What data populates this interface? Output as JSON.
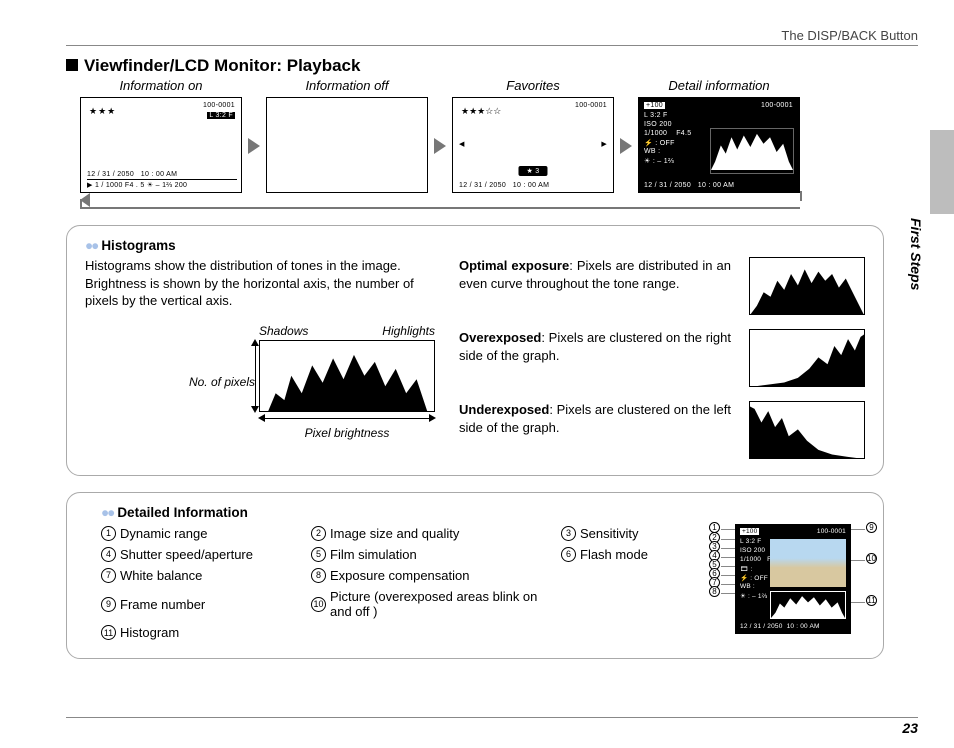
{
  "header_right": "The DISP/BACK Button",
  "section_title": "Viewfinder/LCD Monitor: Playback",
  "side_tab": "First Steps",
  "screens": {
    "s1": {
      "label": "Information on",
      "frame": "100-0001",
      "star": "★★★",
      "mode": "L 3:2 F",
      "date": "12 / 31 / 2050",
      "time": "10 : 00  AM",
      "bottom": "1 / 1000      F4 . 5      ☀ – 1⅔     200"
    },
    "s2": {
      "label": "Information off"
    },
    "s3": {
      "label": "Favorites",
      "frame": "100-0001",
      "star": "★★★☆☆",
      "badge": "★  3",
      "date": "12 / 31 / 2050",
      "time": "10 : 00  AM"
    },
    "s4": {
      "label": "Detail information",
      "frame": "100-0001",
      "dr": "+100",
      "mode": "L 3:2 F",
      "iso": "ISO 200",
      "ss": "1/1000",
      "ap": "F4.5",
      "flash": "⚡ : OFF",
      "wb": "WB :",
      "ec": "☀ : – 1⅔",
      "date": "12 / 31 / 2050",
      "time": "10 : 00  AM"
    }
  },
  "hist": {
    "title": "Histograms",
    "desc": "Histograms show the distribution of tones in the image.   Brightness is shown by the horizontal axis, the number of pixels by the vertical axis.",
    "y_label": "No. of pixels",
    "shadows": "Shadows",
    "highlights": "Highlights",
    "x_label": "Pixel brightness",
    "rows": [
      {
        "b": "Optimal exposure",
        "t": ": Pixels are distributed in an even curve throughout the tone range."
      },
      {
        "b": "Overexposed",
        "t": ": Pixels are clustered on the right side of the graph."
      },
      {
        "b": "Underexposed",
        "t": ": Pixels are clustered on the left side of the graph."
      }
    ]
  },
  "det": {
    "title": "Detailed Information",
    "items": [
      "Dynamic range",
      "Image size and quality",
      "Sensitivity",
      "Shutter speed/aperture",
      "Film simulation",
      "Flash mode",
      "White balance",
      "Exposure compensation",
      "",
      "Frame number",
      "Picture (overexposed areas blink on and off )",
      "",
      "Histogram",
      "",
      ""
    ],
    "nums": [
      "1",
      "2",
      "3",
      "4",
      "5",
      "6",
      "7",
      "8",
      "",
      "9",
      "10",
      "",
      "11",
      "",
      ""
    ]
  },
  "page_num": "23"
}
